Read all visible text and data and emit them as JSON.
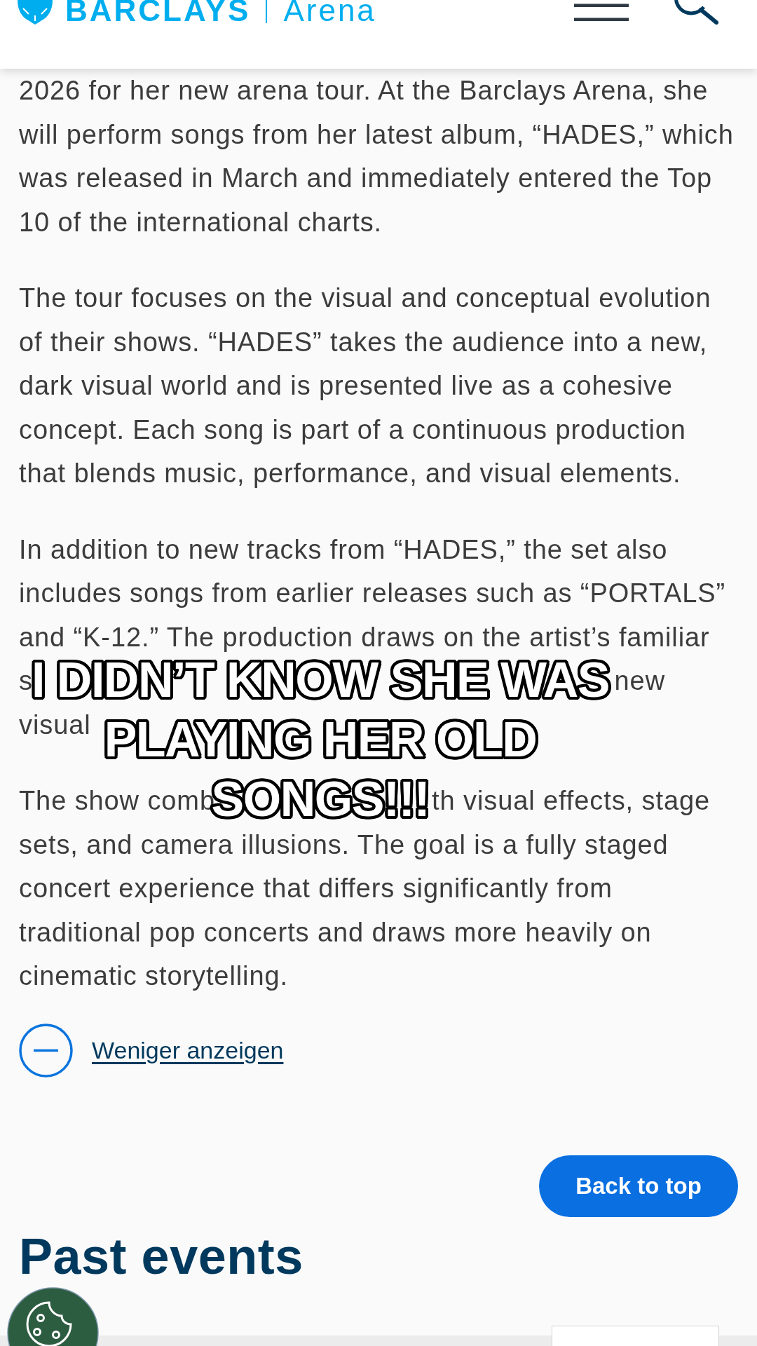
{
  "header": {
    "logo_name": "BARCLAYS",
    "logo_suffix": "Arena"
  },
  "article": {
    "paragraphs": [
      {
        "lines": [
          {
            "kind": "full",
            "text": "2026 for her new arena tour. At the Barclays Arena, she"
          },
          {
            "kind": "full",
            "text": "will perform songs from her latest album, “HADES,” which"
          },
          {
            "kind": "full",
            "text": "was released in March and immediately entered the Top"
          },
          {
            "kind": "full",
            "text": "10 of the international charts."
          }
        ]
      },
      {
        "lines": [
          {
            "kind": "full",
            "text": "The tour focuses on the visual and conceptual evolution"
          },
          {
            "kind": "full",
            "text": "of their shows. “HADES” takes the audience into a new,"
          },
          {
            "kind": "full",
            "text": "dark visual world and is presented live as a cohesive"
          },
          {
            "kind": "full",
            "text": "concept. Each song is part of a continuous production"
          },
          {
            "kind": "full",
            "text": "that blends music, performance, and visual elements."
          }
        ]
      },
      {
        "lines": [
          {
            "kind": "full",
            "text": "In addition to new tracks from “HADES,” the set also"
          },
          {
            "kind": "full",
            "text": "includes songs from earlier releases such as “PORTALS”"
          },
          {
            "kind": "full",
            "text": "and “K-12.” The production draws on the artist’s familiar"
          },
          {
            "kind": "split",
            "left": "s",
            "right": "new"
          },
          {
            "kind": "full",
            "text": "visual"
          }
        ]
      },
      {
        "lines": [
          {
            "kind": "split",
            "left": "The show comb",
            "right": "th visual effects, stage"
          },
          {
            "kind": "full",
            "text": "sets, and camera illusions. The goal is a fully staged"
          },
          {
            "kind": "full",
            "text": "concert experience that differs significantly from"
          },
          {
            "kind": "full",
            "text": "traditional pop concerts and draws more heavily on"
          },
          {
            "kind": "full",
            "text": "cinematic storytelling."
          }
        ]
      }
    ]
  },
  "toggle": {
    "label": "Weniger anzeigen",
    "expanded": true
  },
  "back_to_top": {
    "label": "Back to top"
  },
  "past_events": {
    "title": "Past events"
  },
  "caption": {
    "lines": [
      "I DIDN’T KNOW SHE WAS",
      "PLAYING HER OLD",
      "SONGS!!!"
    ]
  }
}
